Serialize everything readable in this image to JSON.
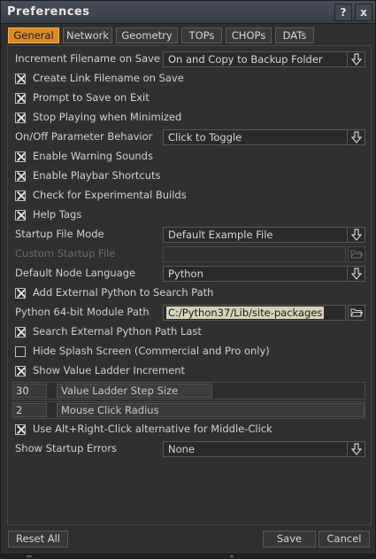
{
  "window": {
    "title": "Preferences",
    "help_label": "?",
    "close_label": "x"
  },
  "tabs": [
    {
      "label": "General",
      "active": true
    },
    {
      "label": "Network",
      "active": false
    },
    {
      "label": "Geometry",
      "active": false
    },
    {
      "label": "TOPs",
      "active": false
    },
    {
      "label": "CHOPs",
      "active": false
    },
    {
      "label": "DATs",
      "active": false
    }
  ],
  "general": {
    "increment_filename": {
      "label": "Increment Filename on Save",
      "value": "On and Copy to Backup Folder"
    },
    "create_link_filename": {
      "label": "Create Link Filename on Save",
      "checked": true
    },
    "prompt_to_save": {
      "label": "Prompt to Save on Exit",
      "checked": true
    },
    "stop_playing": {
      "label": "Stop Playing when Minimized",
      "checked": true
    },
    "onoff_behavior": {
      "label": "On/Off Parameter Behavior",
      "value": "Click to Toggle"
    },
    "warning_sounds": {
      "label": "Enable Warning Sounds",
      "checked": true
    },
    "playbar_shortcuts": {
      "label": "Enable Playbar Shortcuts",
      "checked": true
    },
    "experimental_builds": {
      "label": "Check for Experimental Builds",
      "checked": true
    },
    "help_tags": {
      "label": "Help Tags",
      "checked": true
    },
    "startup_file_mode": {
      "label": "Startup File Mode",
      "value": "Default Example File"
    },
    "custom_startup_file": {
      "label": "Custom Startup File",
      "value": ""
    },
    "default_node_language": {
      "label": "Default Node Language",
      "value": "Python"
    },
    "add_external_python": {
      "label": "Add External Python to Search Path",
      "checked": true
    },
    "python_module_path": {
      "label": "Python 64-bit Module Path",
      "value": "C:/Python37/Lib/site-packages"
    },
    "search_external_last": {
      "label": "Search External Python Path Last",
      "checked": true
    },
    "hide_splash": {
      "label": "Hide Splash Screen (Commercial and Pro only)",
      "checked": false
    },
    "show_value_ladder": {
      "label": "Show Value Ladder Increment",
      "checked": true
    },
    "value_ladder_step": {
      "value": "30",
      "label": "Value Ladder Step Size"
    },
    "mouse_click_radius": {
      "value": "2",
      "label": "Mouse Click Radius"
    },
    "alt_right_click": {
      "label": "Use Alt+Right-Click alternative for Middle-Click",
      "checked": true
    },
    "show_startup_errors": {
      "label": "Show Startup Errors",
      "value": "None"
    }
  },
  "footer": {
    "reset_label": "Reset All",
    "save_label": "Save",
    "cancel_label": "Cancel"
  },
  "colors": {
    "accent": "#d98a2b",
    "background": "#2f2f2f",
    "field": "#2a2a2a",
    "highlight": "#d8d2b8"
  },
  "icons": {
    "dropdown": "dropdown-arrow-icon",
    "folder": "folder-open-icon",
    "checkbox": "checkbox-icon"
  }
}
